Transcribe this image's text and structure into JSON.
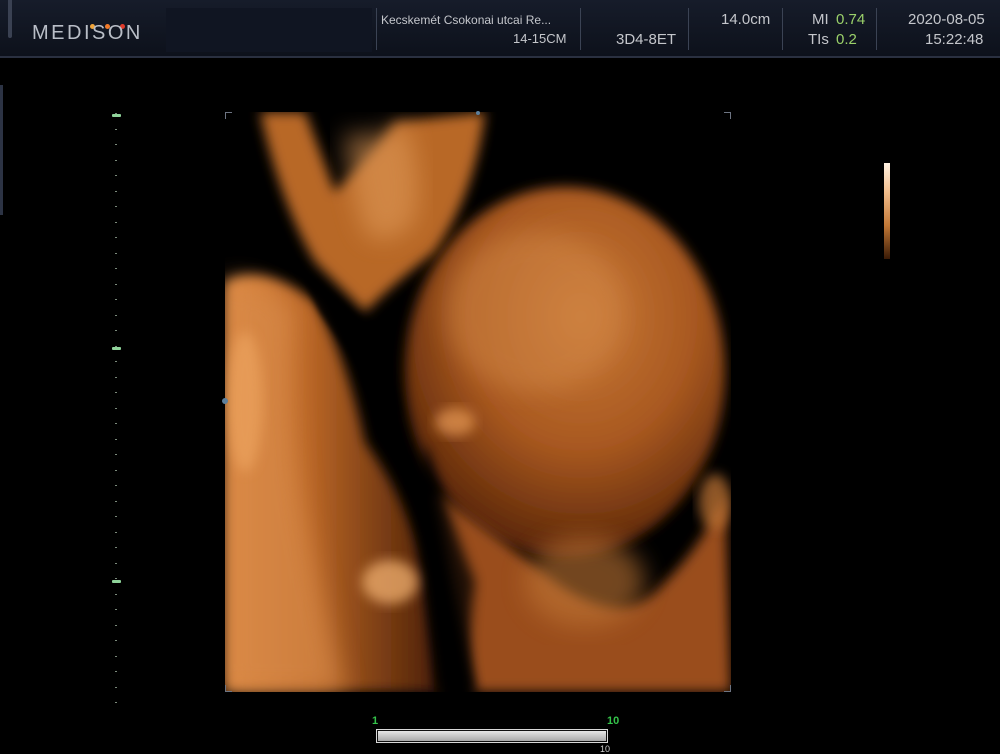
{
  "header": {
    "logo_text": "MEDISON",
    "logo_dot_colors": [
      "#f0a53a",
      "#f07a2a",
      "#e03a2a"
    ],
    "hospital_name": "Kecskemét Csokonai utcai Re...",
    "preset": "14-15CM",
    "probe": "3D4-8ET",
    "depth": "14.0cm",
    "mi_label": "MI",
    "mi_value": "0.74",
    "tis_label": "TIs",
    "tis_value": "0.2",
    "date": "2020-08-05",
    "time": "15:22:48"
  },
  "image": {
    "description_icon": "3d-render-image",
    "palette": {
      "highlight": "#f4c79a",
      "mid": "#c57430",
      "shadow": "#5a2608",
      "background": "#000000"
    }
  },
  "color_bar": {
    "icon": "grayscale-map-bar"
  },
  "slider": {
    "min_label": "1",
    "max_label": "10",
    "current_value": 10,
    "fill_fraction": 1.0,
    "current_label": "10"
  },
  "colors": {
    "accent_green": "#9ad06a",
    "slider_green": "#34c34a",
    "header_bg": "#161c2a"
  }
}
